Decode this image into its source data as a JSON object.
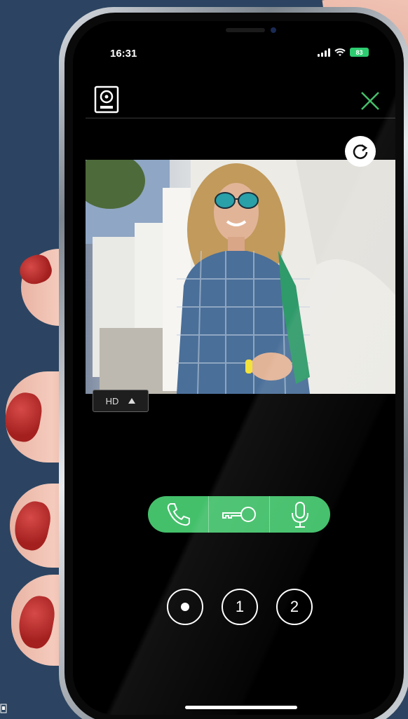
{
  "status_bar": {
    "time": "16:31",
    "battery": "83",
    "icons": [
      "signal-icon",
      "wifi-icon",
      "battery-icon"
    ]
  },
  "header": {
    "device_icon": "doorbell-camera-icon",
    "close_icon": "close-icon"
  },
  "video": {
    "refresh_icon": "refresh-icon",
    "quality_label": "HD",
    "quality_toggle_icon": "caret-up-icon"
  },
  "actions": [
    {
      "name": "call-button",
      "icon": "phone-icon"
    },
    {
      "name": "unlock-button",
      "icon": "key-icon"
    },
    {
      "name": "microphone-button",
      "icon": "microphone-icon"
    }
  ],
  "camera_selectors": [
    {
      "label": "",
      "icon": "dot-icon"
    },
    {
      "label": "1"
    },
    {
      "label": "2"
    }
  ],
  "colors": {
    "accent_green": "#44c06b",
    "background": "#2c4461",
    "screen": "#000000"
  }
}
